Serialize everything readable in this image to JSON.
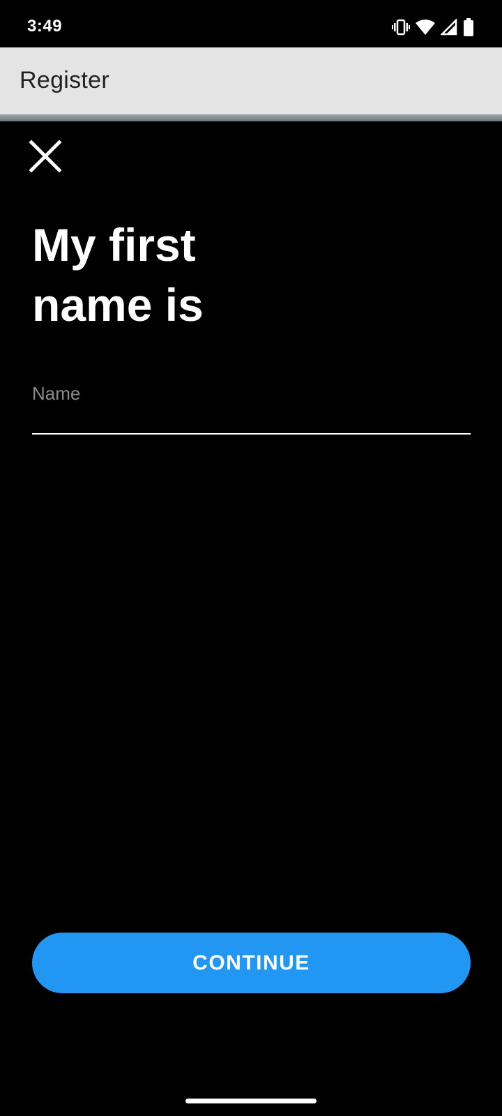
{
  "status_bar": {
    "time": "3:49",
    "icons": [
      "vibrate-icon",
      "wifi-icon",
      "signal-icon",
      "battery-icon"
    ]
  },
  "app_bar": {
    "title": "Register"
  },
  "close_button": {
    "icon": "close-icon"
  },
  "headline": {
    "line1": "My first",
    "line2": "name is"
  },
  "name_input": {
    "value": "",
    "placeholder": "Name"
  },
  "continue_button": {
    "label": "CONTINUE"
  },
  "colors": {
    "background": "#000000",
    "app_bar": "#e4e4e4",
    "accent": "#2196f3",
    "text_primary": "#ffffff",
    "placeholder": "#8b8b8b"
  }
}
